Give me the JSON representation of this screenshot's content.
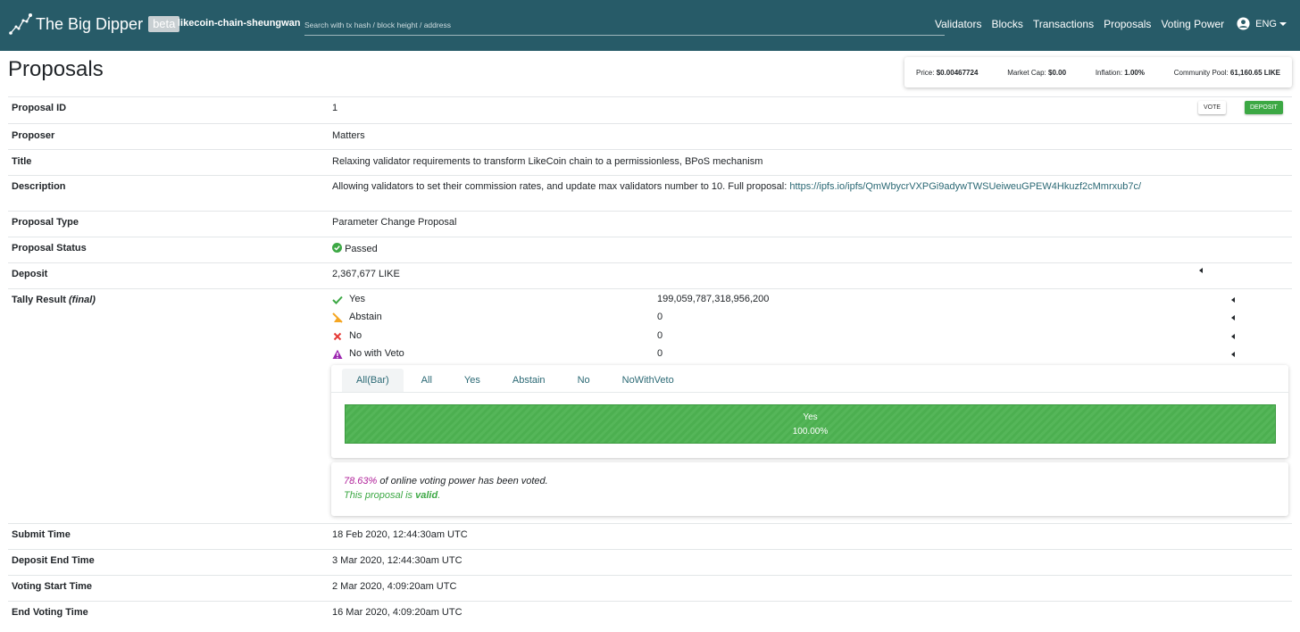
{
  "nav": {
    "brand": "The Big Dipper",
    "beta": "beta",
    "chain_id": "likecoin-chain-sheungwan",
    "search_placeholder": "Search with tx hash / block height / address",
    "links": [
      "Validators",
      "Blocks",
      "Transactions",
      "Proposals",
      "Voting Power"
    ],
    "language": "ENG"
  },
  "page": {
    "title": "Proposals"
  },
  "chain_status": {
    "price_label": "Price:",
    "price": "$0.00467724",
    "market_cap_label": "Market Cap:",
    "market_cap": "$0.00",
    "inflation_label": "Inflation:",
    "inflation": "1.00%",
    "community_pool_label": "Community Pool:",
    "community_pool": "61,160.65 LIKE"
  },
  "proposal": {
    "id_label": "Proposal ID",
    "id": "1",
    "vote_button": "VOTE",
    "deposit_button": "DEPOSIT",
    "proposer_label": "Proposer",
    "proposer": "Matters",
    "title_label": "Title",
    "title": "Relaxing validator requirements to transform LikeCoin chain to a permissionless, BPoS mechanism",
    "description_label": "Description",
    "description": "Allowing validators to set their commission rates, and update max validators number to 10. Full proposal: ",
    "description_link": "https://ipfs.io/ipfs/QmWbycrVXPGi9adywTWSUeiweuGPEW4Hkuzf2cMmrxub7c/",
    "type_label": "Proposal Type",
    "type": "Parameter Change Proposal",
    "status_label": "Proposal Status",
    "status": "Passed",
    "deposit_label": "Deposit",
    "deposit": "2,367,677 LIKE",
    "tally_label": "Tally Result",
    "tally_final": "(final)",
    "submit_time_label": "Submit Time",
    "submit_time": "18 Feb 2020, 12:44:30am UTC",
    "deposit_end_label": "Deposit End Time",
    "deposit_end": "3 Mar 2020, 12:44:30am UTC",
    "voting_start_label": "Voting Start Time",
    "voting_start": "2 Mar 2020, 4:09:20am UTC",
    "voting_end_label": "End Voting Time",
    "voting_end": "16 Mar 2020, 4:09:20am UTC"
  },
  "tally": [
    {
      "name": "Yes",
      "value": "199,059,787,318,956,200",
      "icon": "check-icon",
      "color": "#3ca844"
    },
    {
      "name": "Abstain",
      "value": "0",
      "icon": "abstain-icon",
      "color": "#f5a623"
    },
    {
      "name": "No",
      "value": "0",
      "icon": "cross-icon",
      "color": "#e53935"
    },
    {
      "name": "No with Veto",
      "value": "0",
      "icon": "warning-icon",
      "color": "#9c27b0"
    }
  ],
  "chart_tabs": [
    "All(Bar)",
    "All",
    "Yes",
    "Abstain",
    "No",
    "NoWithVeto"
  ],
  "chart_bar": {
    "label": "Yes",
    "percent": "100.00%",
    "fraction": 1.0
  },
  "voting_power": {
    "percent": "78.63%",
    "text": "of online voting power has been voted.",
    "valid_prefix": "This proposal is",
    "valid_word": "valid",
    "valid_suffix": "."
  },
  "colors": {
    "navbar": "#275b68",
    "accent": "#2a6874",
    "success": "#3ca844",
    "veto": "#b1229a"
  }
}
